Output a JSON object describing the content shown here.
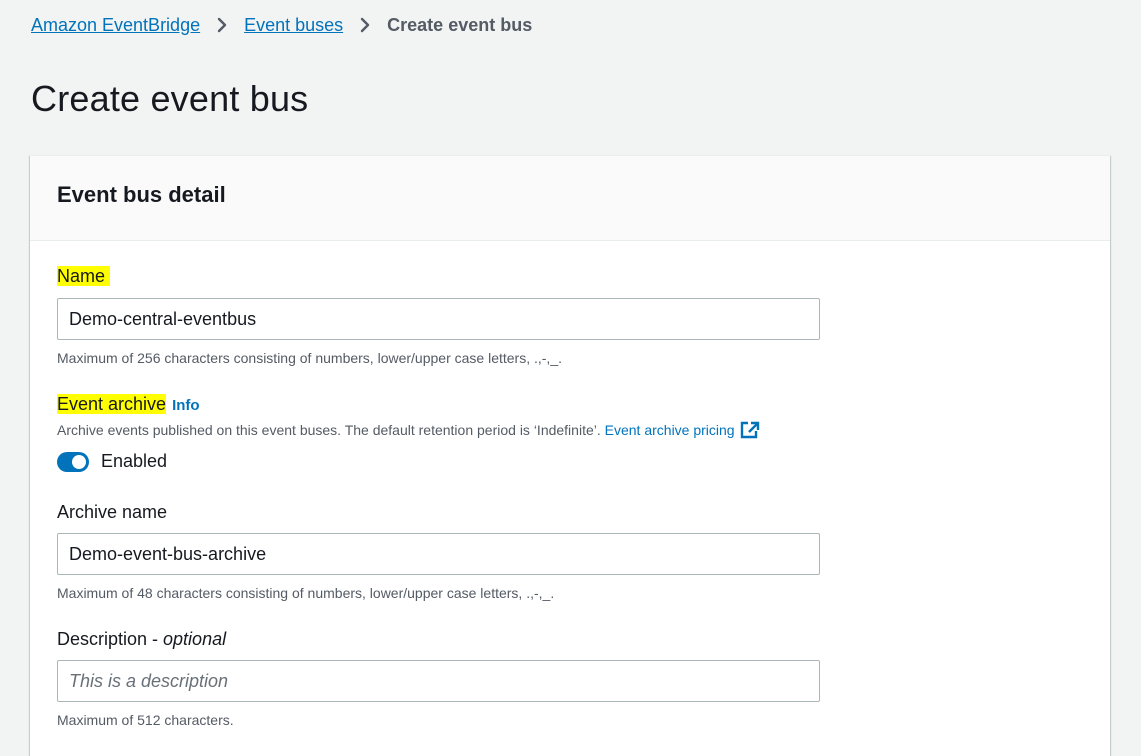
{
  "breadcrumb": {
    "items": [
      {
        "label": "Amazon EventBridge"
      },
      {
        "label": "Event buses"
      }
    ],
    "current": "Create event bus"
  },
  "page": {
    "title": "Create event bus"
  },
  "panel": {
    "title": "Event bus detail"
  },
  "name_field": {
    "label": "Name",
    "value": "Demo-central-eventbus",
    "hint": "Maximum of 256 characters consisting of numbers, lower/upper case letters, .,-,_."
  },
  "event_archive": {
    "label": "Event archive",
    "info_label": "Info",
    "description": "Archive events published on this event buses. The default retention period is ‘Indefinite’.",
    "pricing_link": "Event archive pricing",
    "toggle_label": "Enabled",
    "enabled": true
  },
  "archive_name_field": {
    "label": "Archive name",
    "value": "Demo-event-bus-archive",
    "hint": "Maximum of 48 characters consisting of numbers, lower/upper case letters, .,-,_."
  },
  "description_field": {
    "label": "Description - ",
    "label_optional": "optional",
    "value": "",
    "placeholder": "This is a description",
    "hint": "Maximum of 512 characters."
  },
  "icons": {
    "breadcrumb_separator": "chevron-right-icon",
    "external_link": "external-link-icon"
  },
  "colors": {
    "link": "#0073bb",
    "highlight": "#ffff00",
    "toggle_on": "#0073bb",
    "page_bg": "#f2f3f3"
  }
}
